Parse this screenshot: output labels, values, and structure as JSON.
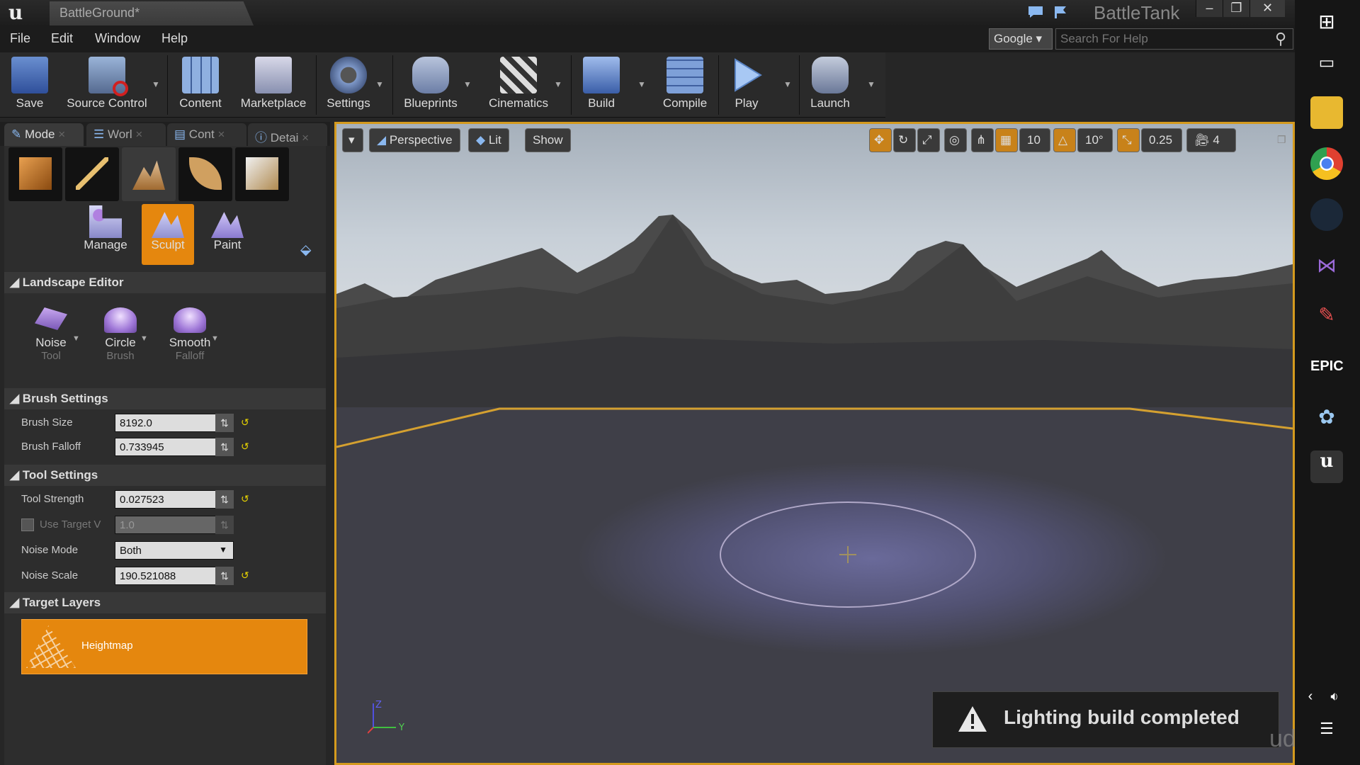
{
  "window": {
    "tab_title": "BattleGround*",
    "project_name": "BattleTank",
    "minimize": "–",
    "restore": "❐",
    "close": "✕"
  },
  "menu": [
    "File",
    "Edit",
    "Window",
    "Help"
  ],
  "search": {
    "engine": "Google",
    "placeholder": "Search For Help"
  },
  "toolbar": [
    "Save",
    "Source Control",
    "Content",
    "Marketplace",
    "Settings",
    "Blueprints",
    "Cinematics",
    "Build",
    "Compile",
    "Play",
    "Launch"
  ],
  "panel_tabs": [
    "Mode",
    "Worl",
    "Cont",
    "Detai"
  ],
  "modes": {
    "tools": [
      "Manage",
      "Sculpt",
      "Paint"
    ],
    "landscape_editor": {
      "title": "Landscape Editor",
      "items": [
        {
          "name": "Noise",
          "sub": "Tool"
        },
        {
          "name": "Circle",
          "sub": "Brush"
        },
        {
          "name": "Smooth",
          "sub": "Falloff"
        }
      ]
    },
    "brush_settings": {
      "title": "Brush Settings",
      "brush_size_label": "Brush Size",
      "brush_size": "8192.0",
      "brush_falloff_label": "Brush Falloff",
      "brush_falloff": "0.733945"
    },
    "tool_settings": {
      "title": "Tool Settings",
      "strength_label": "Tool Strength",
      "strength": "0.027523",
      "use_target_label": "Use Target V",
      "use_target_value": "1.0",
      "noise_mode_label": "Noise Mode",
      "noise_mode": "Both",
      "noise_scale_label": "Noise Scale",
      "noise_scale": "190.521088"
    },
    "target_layers": {
      "title": "Target Layers",
      "layer": "Heightmap"
    }
  },
  "viewport": {
    "perspective": "Perspective",
    "lit": "Lit",
    "show": "Show",
    "grid_snap": "10",
    "rotation_snap": "10°",
    "scale_snap": "0.25",
    "camera_speed": "4"
  },
  "notification": "Lighting build completed",
  "watermark": "udemy",
  "taskbar": {
    "epic_label": "EPIC"
  },
  "colors": {
    "accent": "#e5870e",
    "viewport_border": "#d49a1e"
  }
}
